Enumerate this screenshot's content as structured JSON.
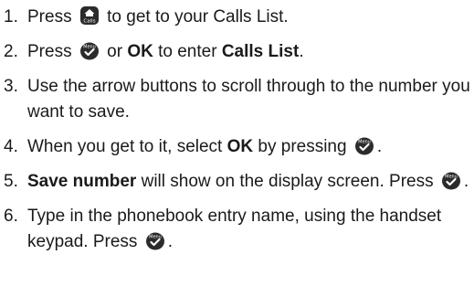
{
  "steps": [
    {
      "number": "1.",
      "parts": {
        "a": "Press",
        "b": "to get to your Calls List."
      },
      "icon": "calls-button-icon",
      "icon_label": "Calls"
    },
    {
      "number": "2.",
      "parts": {
        "a": "Press",
        "b": "or",
        "c": "OK",
        "d": "to enter",
        "e": "Calls List",
        "f": "."
      },
      "icon": "menu-ok-button-icon",
      "icon_label": "Menu"
    },
    {
      "number": "3.",
      "parts": {
        "a": "Use the arrow buttons to scroll through to the number you want to save."
      }
    },
    {
      "number": "4.",
      "parts": {
        "a": "When you get to it, select",
        "b": "OK",
        "c": "by pressing",
        "d": "."
      },
      "icon": "menu-ok-button-icon",
      "icon_label": "Menu"
    },
    {
      "number": "5.",
      "parts": {
        "a": "Save number",
        "b": "will show on the display screen. Press",
        "c": "."
      },
      "icon": "menu-ok-button-icon",
      "icon_label": "Menu"
    },
    {
      "number": "6.",
      "parts": {
        "a": "Type in the phonebook entry name, using the handset keypad. Press",
        "b": "."
      },
      "icon": "menu-ok-button-icon",
      "icon_label": "Menu"
    }
  ],
  "colors": {
    "text": "#1a1a1a",
    "icon_fill": "#2b2b2b",
    "icon_text": "#ffffff"
  }
}
